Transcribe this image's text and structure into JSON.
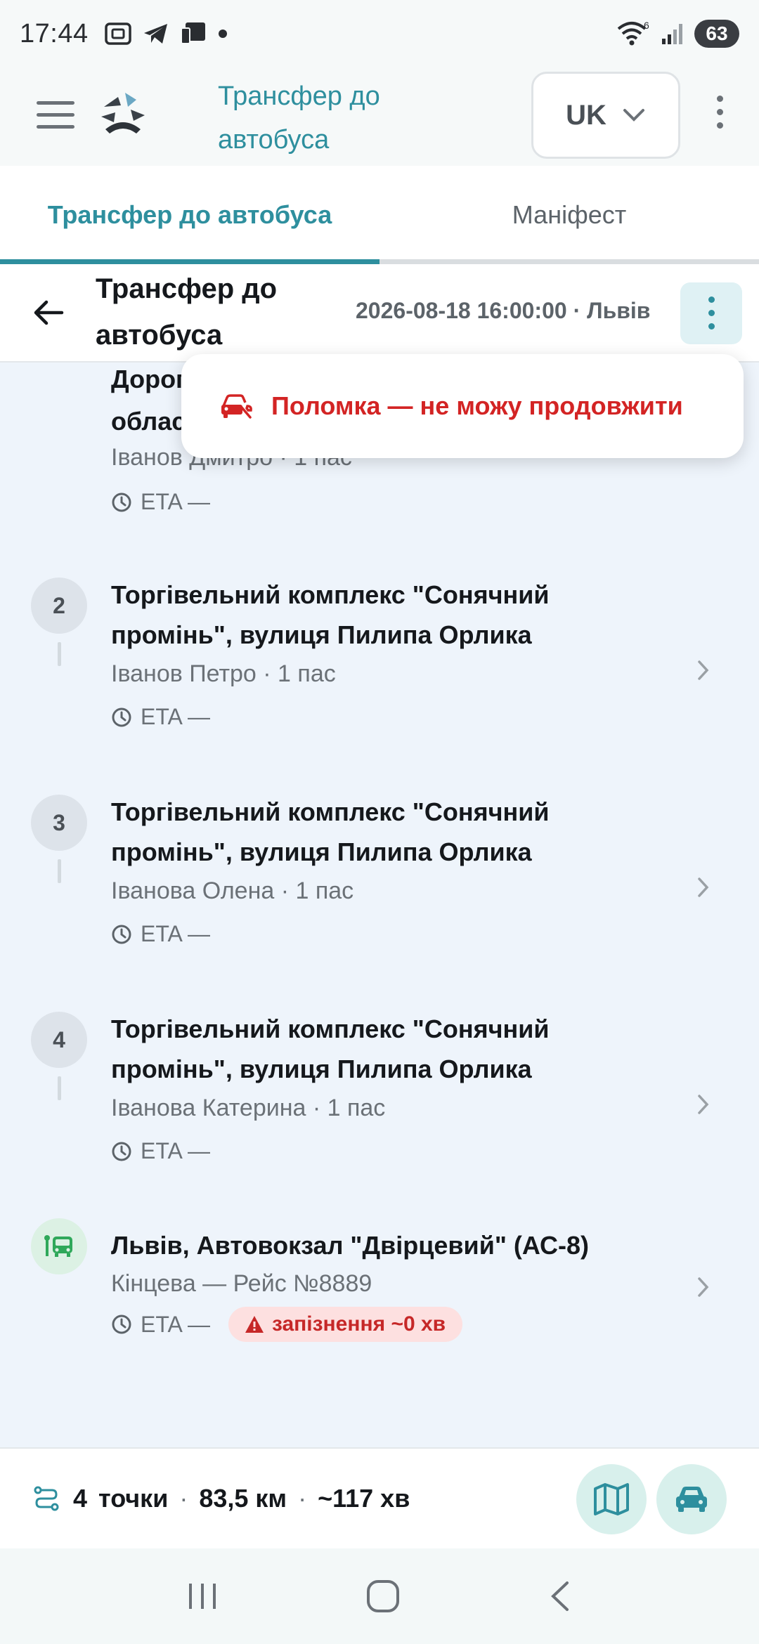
{
  "status_bar": {
    "time": "17:44",
    "battery": "63",
    "signal_badge": "6"
  },
  "app_bar": {
    "title": "Трансфер до автобуса",
    "language": "UK",
    "icons": [
      "menu-icon",
      "app-logo",
      "chevron-down-icon",
      "more-vert-icon"
    ]
  },
  "tabs": [
    {
      "label": "Трансфер до автобуса",
      "active": true
    },
    {
      "label": "Маніфест",
      "active": false
    }
  ],
  "sub_header": {
    "title": "Трансфер до автобуса",
    "meta": "2026-08-18 16:00:00 · Львів"
  },
  "popup_menu": {
    "items": [
      {
        "label": "Поломка — не можу продовжити",
        "icon": "car-breakdown-icon",
        "color": "#d32424"
      }
    ]
  },
  "stops": [
    {
      "number": "",
      "name": "Дорога, область",
      "name_visible_prefix": "Дорог",
      "name_line2_prefix": "облас",
      "sub": "Іванов Дмитро · 1 пас",
      "eta": "ETA —"
    },
    {
      "number": "2",
      "name": "Торгівельний комплекс \"Сонячний промінь\", вулиця Пилипа Орлика",
      "sub": "Іванов Петро · 1 пас",
      "eta": "ETA —"
    },
    {
      "number": "3",
      "name": "Торгівельний комплекс \"Сонячний промінь\", вулиця Пилипа Орлика",
      "sub": "Іванова Олена · 1 пас",
      "eta": "ETA —"
    },
    {
      "number": "4",
      "name": "Торгівельний комплекс \"Сонячний промінь\", вулиця Пилипа Орлика",
      "sub": "Іванова Катерина · 1 пас",
      "eta": "ETA —"
    }
  ],
  "destination": {
    "name": "Львів, Автовокзал \"Двірцевий\" (АС-8)",
    "sub": "Кінцева — Рейс №8889",
    "eta": "ETA —",
    "delay": "запізнення ~0 хв"
  },
  "summary": {
    "points_count": "4",
    "points_label": "точки",
    "distance": "83,5 км",
    "duration": "~117 хв"
  },
  "colors": {
    "accent": "#2e8f9e",
    "danger": "#d32424",
    "background": "#eef4fb",
    "destination_icon": "#2fa85a"
  }
}
